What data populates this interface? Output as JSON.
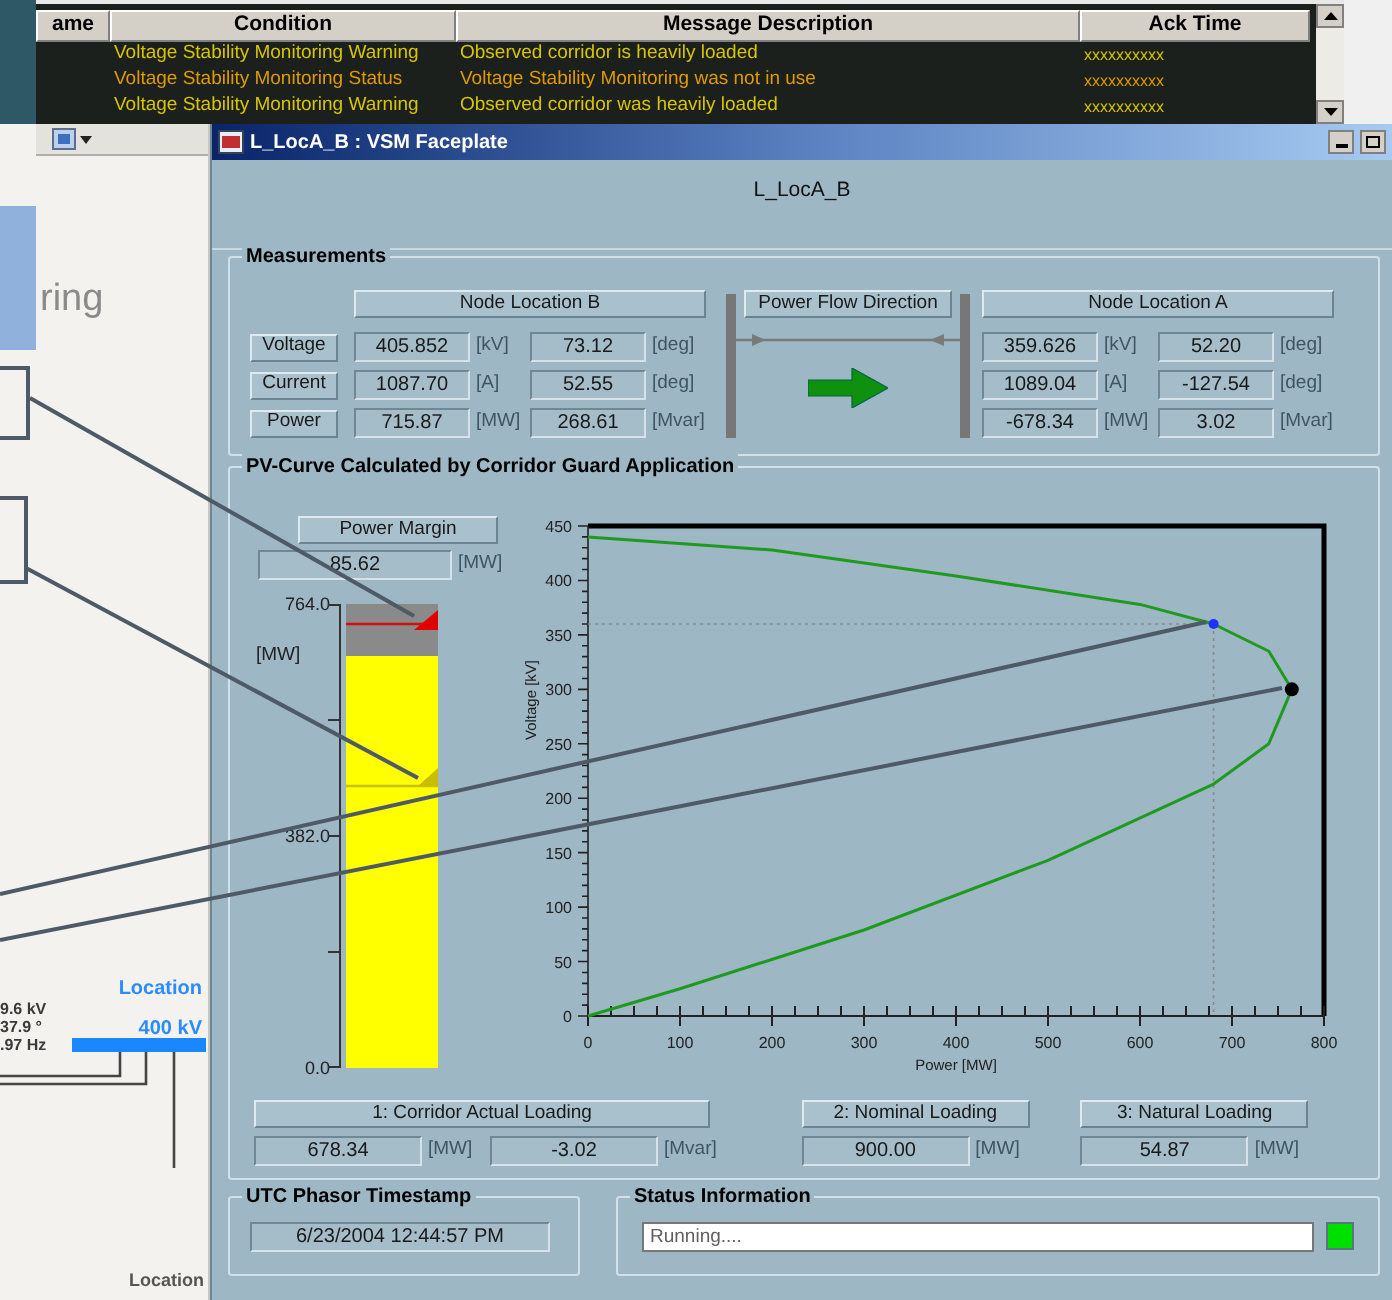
{
  "alarm_list": {
    "columns": [
      "ame",
      "Condition",
      "Message Description",
      "Ack Time"
    ],
    "rows": [
      {
        "condition": "Voltage Stability Monitoring Warning",
        "message": "Observed corridor is heavily loaded",
        "ack_time": "xxxxxxxxxx",
        "color": "#d8c400"
      },
      {
        "condition": "Voltage Stability Monitoring Status",
        "message": "Voltage Stability Monitoring was not in use",
        "ack_time": "xxxxxxxxxx",
        "color": "#e09a00"
      },
      {
        "condition": "Voltage Stability Monitoring Warning",
        "message": "Observed corridor was heavily loaded",
        "ack_time": "xxxxxxxxxx",
        "color": "#d8c400"
      }
    ]
  },
  "background_display": {
    "title_fragment": "ring",
    "location_top": "Location",
    "voltage_level": "400 kV",
    "readings": [
      "9.6 kV",
      "37.9 °",
      ".97 Hz"
    ],
    "location_bottom": "Location"
  },
  "faceplate": {
    "title": "L_LocA_B : VSM Faceplate",
    "heading": "L_LocA_B",
    "measurements": {
      "title": "Measurements",
      "node_b": "Node Location B",
      "flow_label": "Power Flow Direction",
      "flow_b_to_a": true,
      "node_a": "Node Location A",
      "rows": [
        {
          "label": "Voltage",
          "node_b": [
            {
              "value": "405.852",
              "unit": "[kV]"
            },
            {
              "value": "73.12",
              "unit": "[deg]"
            }
          ],
          "node_a": [
            {
              "value": "359.626",
              "unit": "[kV]"
            },
            {
              "value": "52.20",
              "unit": "[deg]"
            }
          ]
        },
        {
          "label": "Current",
          "node_b": [
            {
              "value": "1087.70",
              "unit": "[A]"
            },
            {
              "value": "52.55",
              "unit": "[deg]"
            }
          ],
          "node_a": [
            {
              "value": "1089.04",
              "unit": "[A]"
            },
            {
              "value": "-127.54",
              "unit": "[deg]"
            }
          ]
        },
        {
          "label": "Power",
          "node_b": [
            {
              "value": "715.87",
              "unit": "[MW]"
            },
            {
              "value": "268.61",
              "unit": "[Mvar]"
            }
          ],
          "node_a": [
            {
              "value": "-678.34",
              "unit": "[MW]"
            },
            {
              "value": "3.02",
              "unit": "[Mvar]"
            }
          ]
        }
      ]
    },
    "pv_curve": {
      "title": "PV-Curve Calculated by Corridor Guard Application",
      "power_margin": {
        "label": "Power Margin",
        "value": "85.62",
        "unit": "[MW]",
        "scale": [
          "764.0",
          "382.0",
          "0.0"
        ],
        "scale_unit": "[MW]",
        "level": 0.89,
        "markers": [
          {
            "kind": "limit",
            "level": 0.96
          },
          {
            "kind": "threshold",
            "level": 0.62
          }
        ]
      },
      "chart_data": {
        "type": "line",
        "xlabel": "Power [MW]",
        "ylabel": "Voltage [kV]",
        "xlim": [
          0,
          800
        ],
        "ylim": [
          0,
          450
        ],
        "xticks": [
          0,
          100,
          200,
          300,
          400,
          500,
          600,
          700,
          800
        ],
        "yticks": [
          0,
          50,
          100,
          150,
          200,
          250,
          300,
          350,
          400,
          450
        ],
        "x": [
          0,
          200,
          400,
          600,
          680,
          740,
          765,
          740,
          680,
          500,
          300,
          100,
          0
        ],
        "series": [
          {
            "color": "#1f9a1f",
            "values": [
              440,
              428,
              404,
              378,
              360,
              335,
              300,
              250,
              213,
              143,
              79,
              25,
              0
            ]
          }
        ],
        "ref_lines": [
          {
            "axis": "y",
            "value": 360
          },
          {
            "axis": "x",
            "value": 680
          }
        ]
      },
      "loadings": [
        {
          "label": "1: Corridor Actual Loading",
          "fields": [
            {
              "value": "678.34",
              "unit": "[MW]"
            },
            {
              "value": "-3.02",
              "unit": "[Mvar]"
            }
          ]
        },
        {
          "label": "2: Nominal Loading",
          "fields": [
            {
              "value": "900.00",
              "unit": "[MW]"
            }
          ]
        },
        {
          "label": "3: Natural Loading",
          "fields": [
            {
              "value": "54.87",
              "unit": "[MW]"
            }
          ]
        }
      ]
    },
    "timestamp": {
      "title": "UTC Phasor Timestamp",
      "value": "6/23/2004 12:44:57 PM"
    },
    "status": {
      "title": "Status Information",
      "value": "Running....",
      "color": "#00e000"
    }
  }
}
